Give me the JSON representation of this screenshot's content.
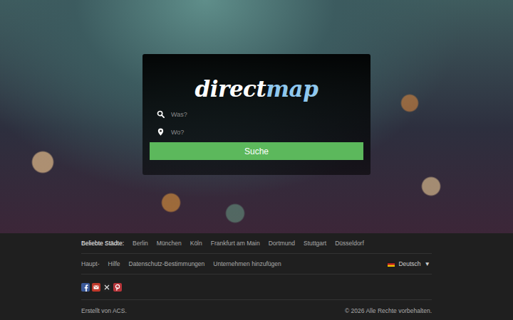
{
  "logo": {
    "first": "direct",
    "second": "map"
  },
  "search": {
    "what_placeholder": "Was?",
    "where_placeholder": "Wo?",
    "button": "Suche"
  },
  "footer": {
    "cities_label": "Beliebte Städte:",
    "cities": [
      "Berlin",
      "München",
      "Köln",
      "Frankfurt am Main",
      "Dortmund",
      "Stuttgart",
      "Düsseldorf"
    ],
    "links": [
      "Haupt-",
      "Hilfe",
      "Datenschutz-Bestimmungen",
      "Unternehmen hinzufügen"
    ],
    "language": "Deutsch",
    "language_arrow": "▼",
    "credit": "Erstellt von ACS.",
    "copyright": "© 2026 Alle Rechte vorbehalten."
  }
}
